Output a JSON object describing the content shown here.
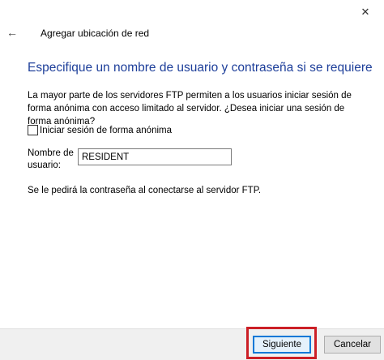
{
  "window": {
    "close_glyph": "✕",
    "back_glyph": "←",
    "wizard_title": "Agregar ubicación de red"
  },
  "main": {
    "heading": "Especifique un nombre de usuario y contraseña si se requiere",
    "description": "La mayor parte de los servidores FTP permiten a los usuarios iniciar sesión de forma anónima con acceso limitado al servidor. ¿Desea iniciar una sesión de forma anónima?",
    "anonymous_checkbox": {
      "label": "Iniciar sesión de forma anónima",
      "checked": false
    },
    "username": {
      "label": "Nombre de usuario:",
      "value": "RESIDENT"
    },
    "password_note": "Se le pedirá la contraseña al conectarse al servidor FTP."
  },
  "footer": {
    "next_label": "Siguiente",
    "cancel_label": "Cancelar"
  },
  "colors": {
    "heading": "#1e3f9a",
    "highlight": "#cc1f26",
    "default_button_border": "#0078d7"
  },
  "icons": {
    "close": "close-icon",
    "back": "back-arrow-icon"
  }
}
